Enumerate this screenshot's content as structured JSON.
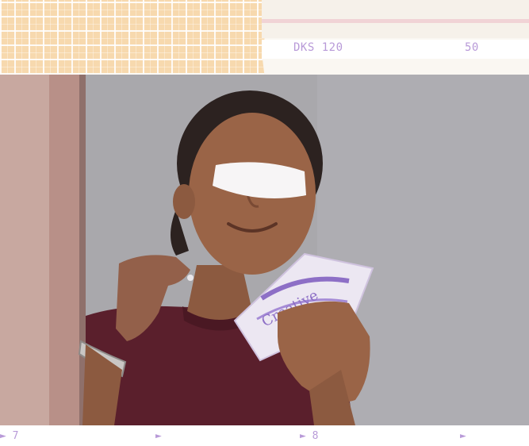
{
  "film_header": {
    "code": "DKS 120",
    "number": "50"
  },
  "film_footer": {
    "marks": [
      {
        "arrow": "►",
        "number": "7"
      },
      {
        "arrow": "►",
        "number": ""
      },
      {
        "arrow": "►",
        "number": "8"
      },
      {
        "arrow": "►",
        "number": ""
      }
    ]
  },
  "colors": {
    "film_text": "#b89ad8",
    "tape": "#f7d9ae",
    "paper": "#f6f1ea",
    "shirt": "#5a1f2c",
    "wall": "#a9a8ac"
  },
  "photo": {
    "icon": "portrait-photo",
    "packet_label": "Creative"
  }
}
